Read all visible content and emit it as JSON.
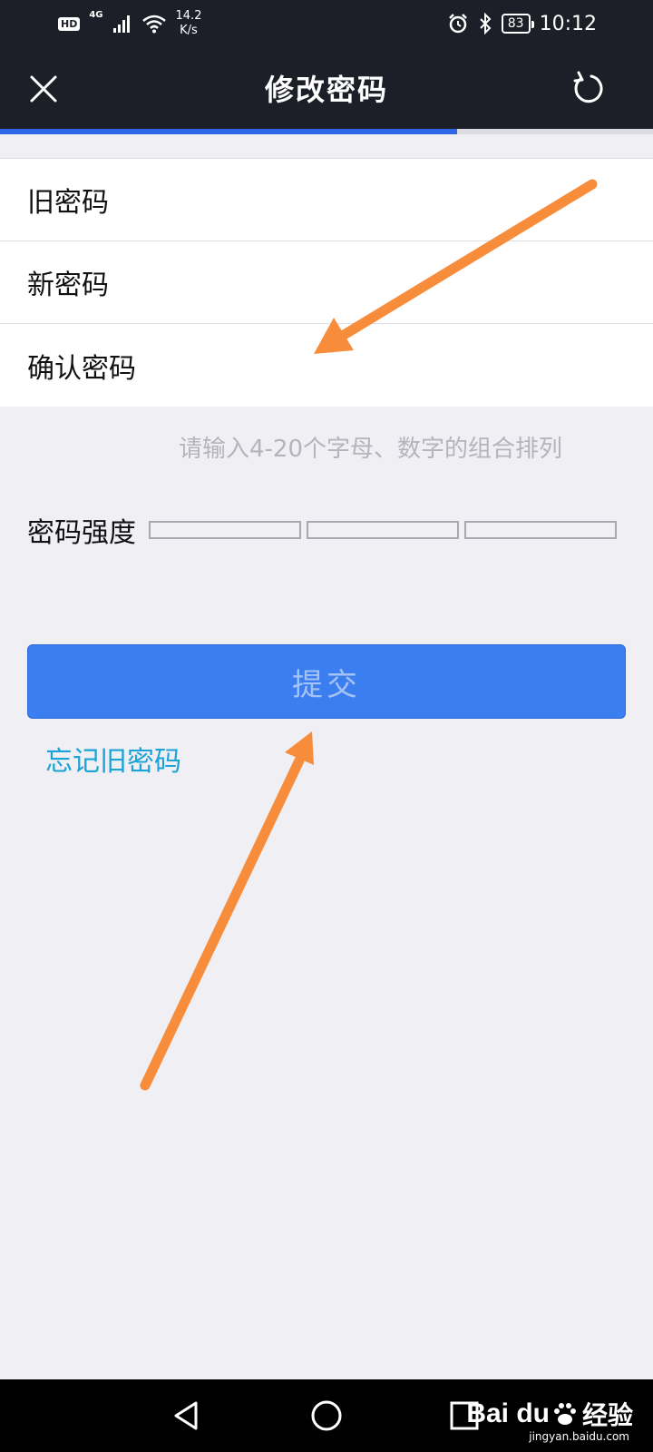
{
  "status_bar": {
    "hd_badge": "HD",
    "network": "4G",
    "speed_value": "14.2",
    "speed_unit": "K/s",
    "battery": "83",
    "time": "10:12",
    "icons": [
      "signal-icon",
      "wifi-icon",
      "alarm-icon",
      "bluetooth-icon",
      "battery-icon"
    ]
  },
  "header": {
    "title": "修改密码",
    "left_icon": "close-icon",
    "right_icon": "refresh-icon"
  },
  "page_load_progress": 0.7,
  "form": {
    "fields": [
      {
        "label": "旧密码",
        "value": ""
      },
      {
        "label": "新密码",
        "value": ""
      },
      {
        "label": "确认密码",
        "value": ""
      }
    ]
  },
  "hint": "请输入4-20个字母、数字的组合排列",
  "strength": {
    "label": "密码强度",
    "segments": 3,
    "filled": 0
  },
  "submit_label": "提交",
  "forgot_link": "忘记旧密码",
  "annotations": {
    "arrow_color": "#f78c3b"
  },
  "system_nav": {
    "icons": [
      "back-icon",
      "home-icon",
      "recents-icon"
    ]
  },
  "watermark": {
    "brand": "Bai du",
    "brand_suffix": "经验",
    "url": "jingyan.baidu.com"
  },
  "colors": {
    "header_bg": "#1c1f27",
    "accent": "#2f66e8",
    "button": "#3a7ef0",
    "link": "#1aa3d6",
    "page_bg": "#efeff4"
  }
}
